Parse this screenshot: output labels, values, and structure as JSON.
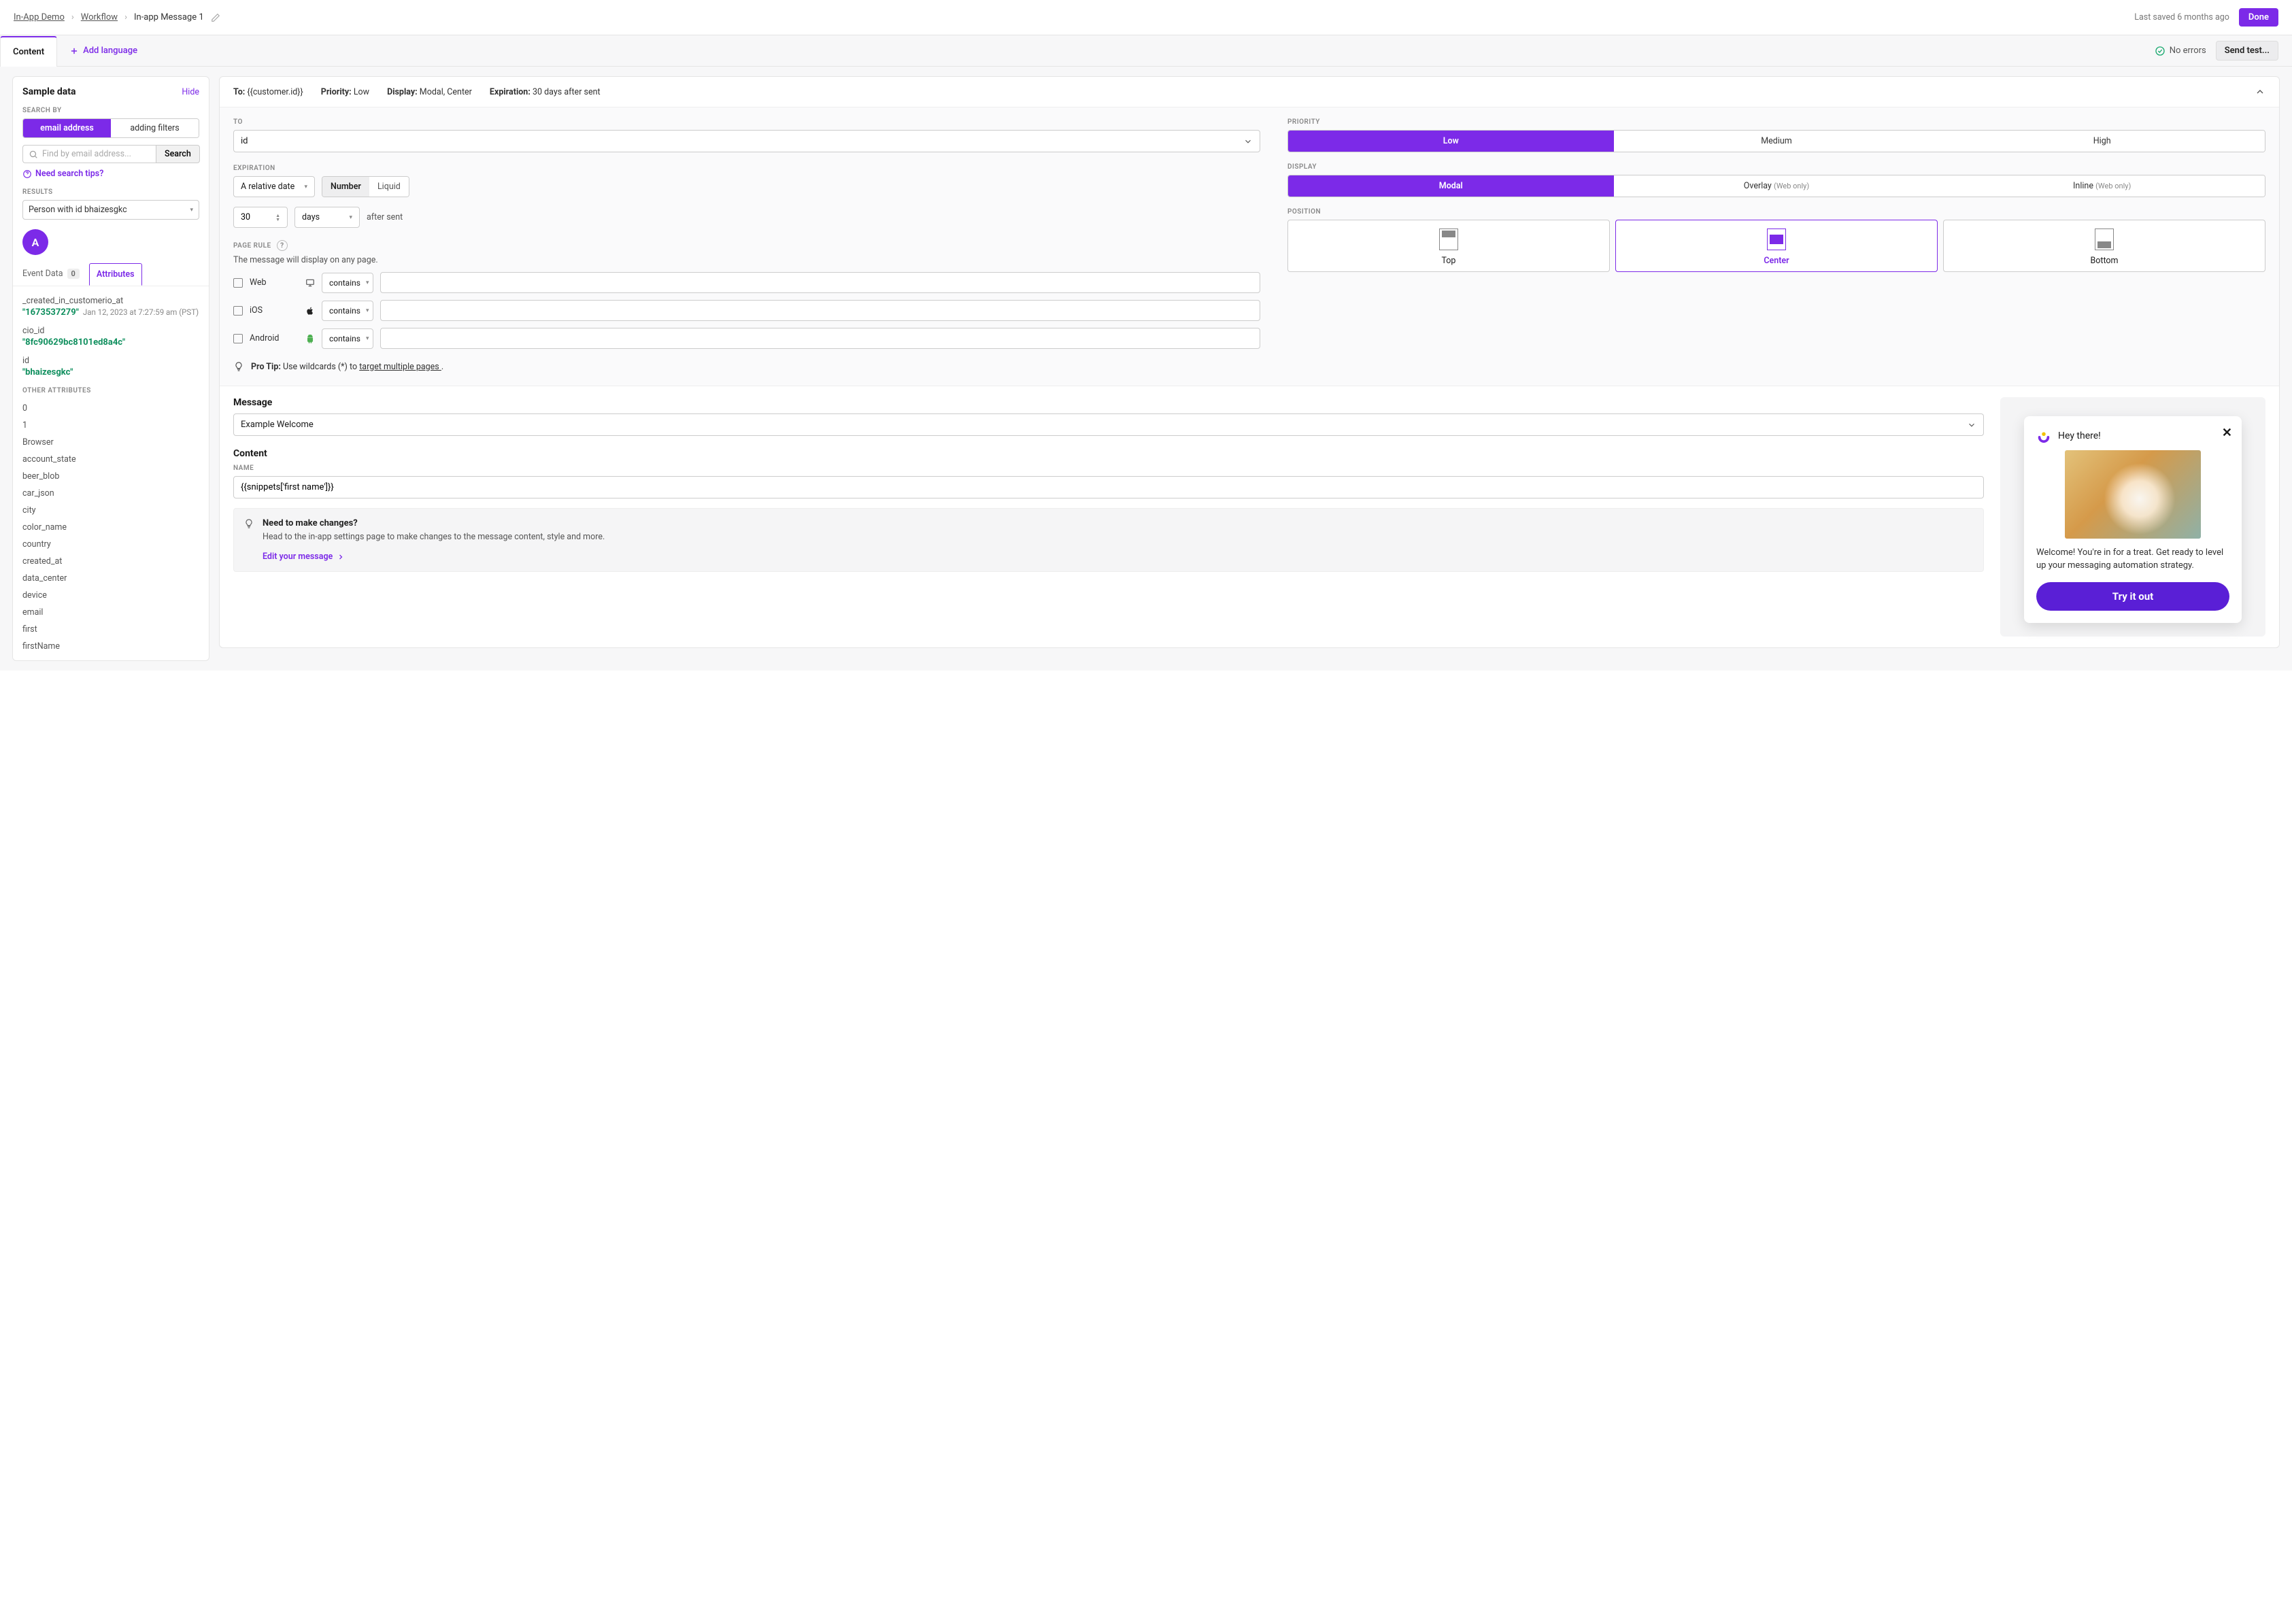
{
  "breadcrumbs": {
    "items": [
      "In-App Demo",
      "Workflow",
      "In-app Message 1"
    ]
  },
  "header": {
    "lastSaved": "Last saved 6 months ago",
    "done": "Done"
  },
  "subbar": {
    "contentTab": "Content",
    "addLanguage": "Add language",
    "noErrors": "No errors",
    "sendTest": "Send test..."
  },
  "sidebar": {
    "title": "Sample data",
    "hide": "Hide",
    "searchByLabel": "SEARCH BY",
    "searchModes": [
      "email address",
      "adding filters"
    ],
    "searchPlaceholder": "Find by email address...",
    "searchBtn": "Search",
    "tips": "Need search tips?",
    "resultsLabel": "RESULTS",
    "resultValue": "Person with id bhaizesgkc",
    "avatarLetter": "A",
    "eventDataTab": "Event Data",
    "eventDataCount": "0",
    "attributesTab": "Attributes",
    "attrs": [
      {
        "key": "_created_in_customerio_at",
        "val": "\"1673537279\"",
        "meta": "Jan 12, 2023 at 7:27:59 am (PST)"
      },
      {
        "key": "cio_id",
        "val": "\"8fc90629bc8101ed8a4c\""
      },
      {
        "key": "id",
        "val": "\"bhaizesgkc\""
      }
    ],
    "otherLabel": "OTHER ATTRIBUTES",
    "other": [
      "0",
      "1",
      "Browser",
      "account_state",
      "beer_blob",
      "car_json",
      "city",
      "color_name",
      "country",
      "created_at",
      "data_center",
      "device",
      "email",
      "first",
      "firstName"
    ]
  },
  "summary": {
    "toLabel": "To:",
    "toValue": "{{customer.id}}",
    "priorityLabel": "Priority:",
    "priorityValue": "Low",
    "displayLabel": "Display:",
    "displayValue": "Modal, Center",
    "expirationLabel": "Expiration:",
    "expirationValue": "30 days after sent"
  },
  "config": {
    "toLabel": "TO",
    "toValue": "id",
    "expirationLabel": "EXPIRATION",
    "relDate": "A relative date",
    "numberTab": "Number",
    "liquidTab": "Liquid",
    "numVal": "30",
    "unit": "days",
    "afterSent": "after sent",
    "pageRuleLabel": "PAGE RULE",
    "pageRuleText": "The message will display on any page.",
    "platforms": {
      "web": "Web",
      "ios": "iOS",
      "android": "Android"
    },
    "contains": "contains",
    "proTipBold": "Pro Tip:",
    "proTipText": "Use wildcards (*) to ",
    "proTipLink": "target multiple pages ",
    "proTipEnd": ".",
    "priorityLabel": "PRIORITY",
    "priorities": [
      "Low",
      "Medium",
      "High"
    ],
    "displayLabel": "DISPLAY",
    "displays": {
      "modal": "Modal",
      "overlay": "Overlay",
      "inline": "Inline",
      "webOnly": "(Web only)"
    },
    "positionLabel": "POSITION",
    "positions": [
      "Top",
      "Center",
      "Bottom"
    ]
  },
  "message": {
    "heading": "Message",
    "templateValue": "Example Welcome",
    "contentHeading": "Content",
    "nameLabel": "NAME",
    "nameValue": "{{snippets['first name']}}",
    "changesTitle": "Need to make changes?",
    "changesBody": "Head to the in-app settings page to make changes to the message content, style and more.",
    "editLink": "Edit your message"
  },
  "preview": {
    "greeting": "Hey there!",
    "body": "Welcome! You're in for a treat. Get ready to level up your messaging automation strategy.",
    "cta": "Try it out"
  }
}
